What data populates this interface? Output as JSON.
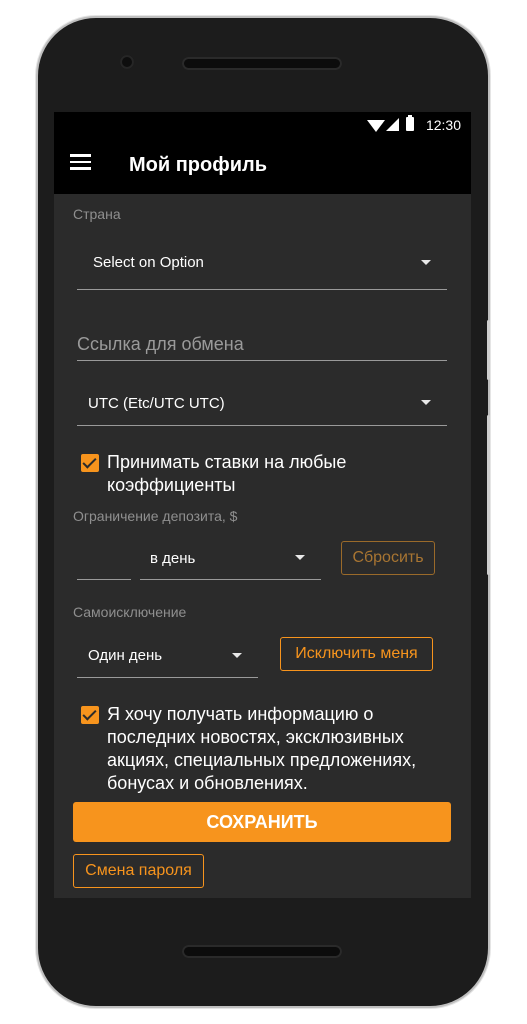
{
  "status_bar": {
    "time": "12:30"
  },
  "app_bar": {
    "title": "Мой профиль"
  },
  "form": {
    "country": {
      "label": "Страна",
      "value": "Select on Option"
    },
    "exchange_link": {
      "placeholder": "Ссылка для обмена"
    },
    "timezone": {
      "value": "UTC (Etc/UTC UTC)"
    },
    "accept_any_odds": {
      "checked": true,
      "label_line1": "Принимать ставки на любые",
      "label_line2": "коэффициенты"
    },
    "deposit_limit": {
      "label": "Ограничение депозита, $",
      "amount": "",
      "period": "в день",
      "reset_button": "Сбросить"
    },
    "self_exclusion": {
      "label": "Самоисключение",
      "period": "Один день",
      "exclude_button": "Исключить меня"
    },
    "newsletter": {
      "checked": true,
      "label_line1": "Я хочу получать информацию о",
      "label_line2": "последних новостях, эксклюзивных",
      "label_line3": "акциях, специальных предложениях,",
      "label_line4": "бонусах и обновлениях."
    },
    "save_button": "СОХРАНИТЬ",
    "change_password_button": "Смена пароля"
  },
  "colors": {
    "accent": "#f7941d",
    "background": "#2b2b2b",
    "appbar": "#000000"
  }
}
